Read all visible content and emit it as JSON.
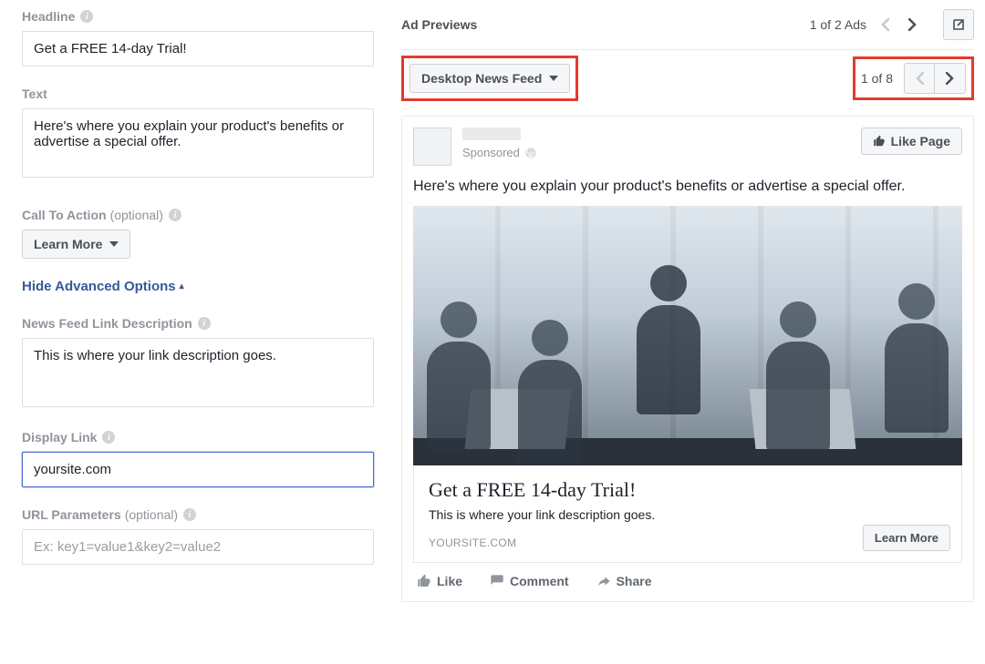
{
  "form": {
    "headline_label": "Headline",
    "headline_value": "Get a FREE 14-day Trial!",
    "text_label": "Text",
    "text_value": "Here's where you explain your product's benefits or advertise a special offer.",
    "cta_label": "Call To Action",
    "cta_optional": "(optional)",
    "cta_value": "Learn More",
    "adv_toggle": "Hide Advanced Options",
    "linkdesc_label": "News Feed Link Description",
    "linkdesc_value": "This is where your link description goes.",
    "displaylink_label": "Display Link",
    "displaylink_value": "yoursite.com",
    "urlparams_label": "URL Parameters",
    "urlparams_optional": "(optional)",
    "urlparams_placeholder": "Ex: key1=value1&key2=value2"
  },
  "preview": {
    "title": "Ad Previews",
    "ads_pager": "1 of 2 Ads",
    "placement_dropdown": "Desktop News Feed",
    "placement_pager": "1 of 8",
    "like_page": "Like Page",
    "sponsored": "Sponsored",
    "post_text": "Here's where you explain your product's benefits or advertise a special offer.",
    "link_title": "Get a FREE 14-day Trial!",
    "link_desc": "This is where your link description goes.",
    "link_domain": "YOURSITE.COM",
    "learn_more": "Learn More",
    "actions": {
      "like": "Like",
      "comment": "Comment",
      "share": "Share"
    }
  }
}
